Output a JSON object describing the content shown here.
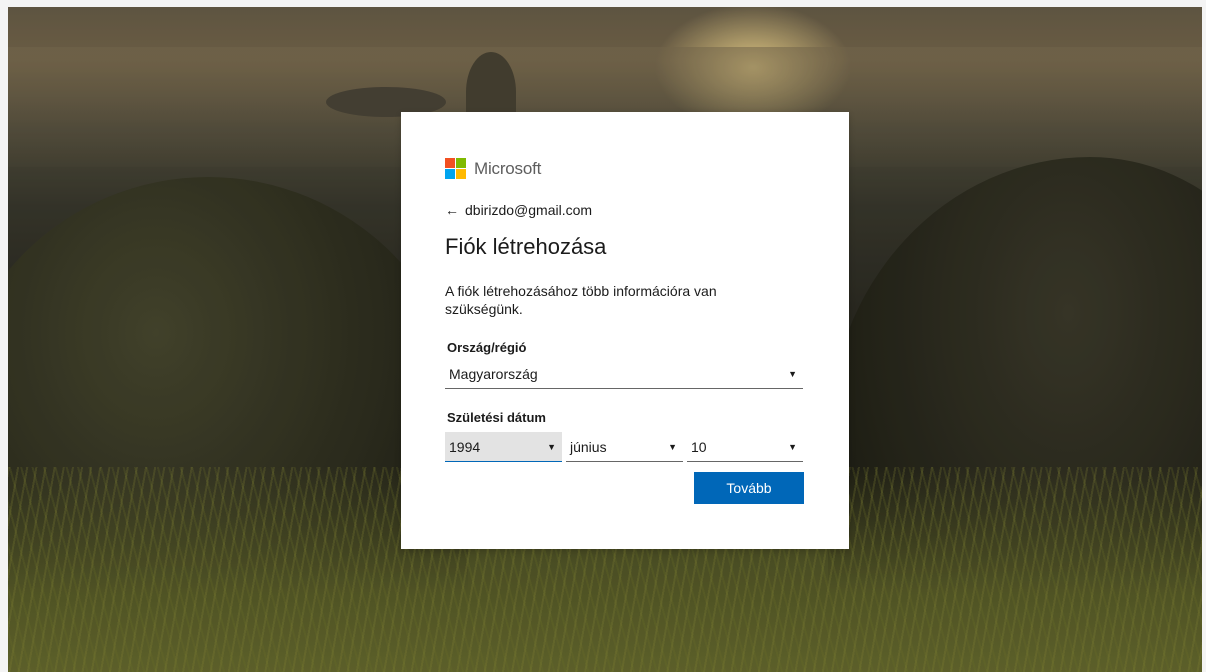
{
  "brand": {
    "name": "Microsoft",
    "logo_colors": [
      "#f25022",
      "#7fba00",
      "#00a4ef",
      "#ffb900"
    ]
  },
  "identity": {
    "back_icon": "back-arrow-icon",
    "email": "dbirizdo@gmail.com"
  },
  "page_title": "Fiók létrehozása",
  "description": "A fiók létrehozásához több információra van szükségünk.",
  "country": {
    "label": "Ország/régió",
    "selected": "Magyarország"
  },
  "birthdate": {
    "label": "Születési dátum",
    "year": "1994",
    "month": "június",
    "day": "10"
  },
  "next_button": "Tovább",
  "colors": {
    "accent": "#0067b8",
    "text": "#1b1b1b"
  }
}
